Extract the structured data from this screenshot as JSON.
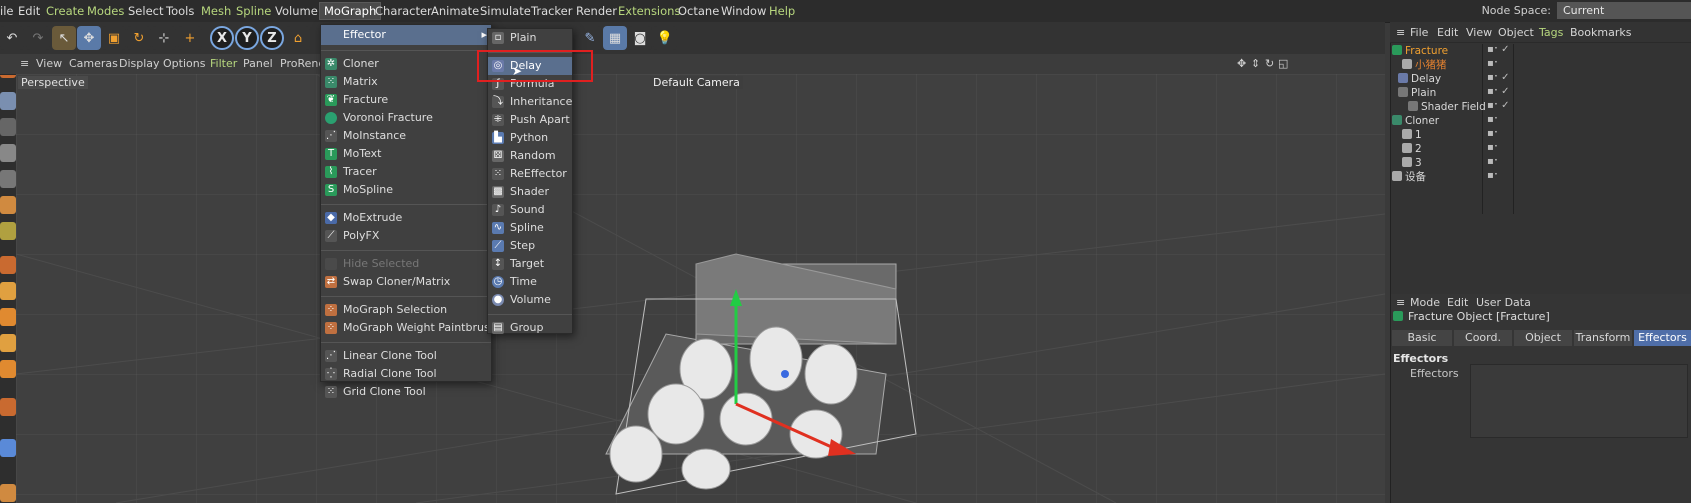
{
  "menubar": {
    "items": [
      "ile",
      "Edit",
      "Create",
      "Modes",
      "Select",
      "Tools",
      "Mesh",
      "Spline",
      "Volume",
      "MoGraph",
      "Character",
      "Animate",
      "Simulate",
      "Tracker",
      "Render",
      "Extensions",
      "Octane",
      "Window",
      "Help"
    ],
    "node_space_label": "Node Space:",
    "node_space_value": "Current (Standard/Physical)"
  },
  "viewport": {
    "menu": [
      "View",
      "Cameras",
      "Display",
      "Options",
      "Filter",
      "Panel",
      "ProRend"
    ],
    "label": "Perspective",
    "camera": "Default Camera"
  },
  "mograph_menu": {
    "effector_label": "Effector",
    "items": [
      "Cloner",
      "Matrix",
      "Fracture",
      "Voronoi Fracture",
      "MoInstance",
      "MoText",
      "Tracer",
      "MoSpline",
      "MoExtrude",
      "PolyFX",
      "Hide Selected",
      "Swap Cloner/Matrix",
      "MoGraph Selection",
      "MoGraph Weight Paintbrush",
      "Linear Clone Tool",
      "Radial Clone Tool",
      "Grid Clone Tool"
    ]
  },
  "effector_menu": {
    "items": [
      "Plain",
      "Delay",
      "Formula",
      "Inheritance",
      "Push Apart",
      "Python",
      "Random",
      "ReEffector",
      "Shader",
      "Sound",
      "Spline",
      "Step",
      "Target",
      "Time",
      "Volume",
      "Group"
    ]
  },
  "object_manager": {
    "menu": [
      "File",
      "Edit",
      "View",
      "Object",
      "Tags",
      "Bookmarks"
    ],
    "rows": [
      "Fracture",
      "小猪猪",
      "Delay",
      "Plain",
      "Shader Field",
      "Cloner",
      "1",
      "2",
      "3",
      "设备"
    ]
  },
  "attributes": {
    "menu": [
      "Mode",
      "Edit",
      "User Data"
    ],
    "title": "Fracture Object [Fracture]",
    "tabs": [
      "Basic",
      "Coord.",
      "Object",
      "Transform",
      "Effectors"
    ],
    "section": "Effectors",
    "field_label": "Effectors"
  },
  "colors": {
    "accent": "#5a6f8e",
    "green": "#b7d77e",
    "orange": "#e8a040",
    "highlight_box": "#e02020"
  }
}
